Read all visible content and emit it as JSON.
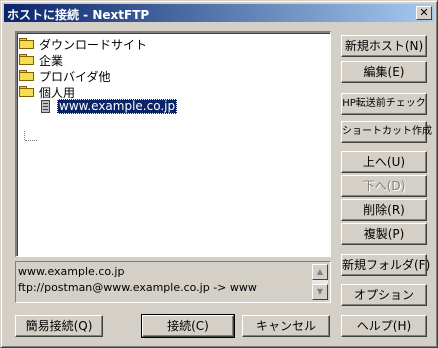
{
  "window": {
    "title": "ホストに接続 - NextFTP",
    "close_glyph": "✕"
  },
  "tree": {
    "folders": [
      {
        "label": "ダウンロードサイト"
      },
      {
        "label": "企業"
      },
      {
        "label": "プロバイダ他"
      },
      {
        "label": "個人用"
      }
    ],
    "selected_host": "www.example.co.jp"
  },
  "info": {
    "line1": "www.example.co.jp",
    "line2": "ftp://postman@www.example.co.jp -> www",
    "scroll_up_glyph": "▲",
    "scroll_down_glyph": "▼"
  },
  "side_buttons": {
    "new_host": "新規ホスト(N)",
    "edit": "編集(E)",
    "hp_check": "HP転送前チェック",
    "shortcut": "ショートカット作成",
    "up": "上へ(U)",
    "down": "下へ(D)",
    "delete": "削除(R)",
    "copy": "複製(P)",
    "new_folder": "新規フォルダ(F)",
    "options": "オプション",
    "help": "ヘルプ(H)"
  },
  "bottom_buttons": {
    "quick_connect": "簡易接続(Q)",
    "connect": "接続(C)",
    "cancel": "キャンセル"
  }
}
